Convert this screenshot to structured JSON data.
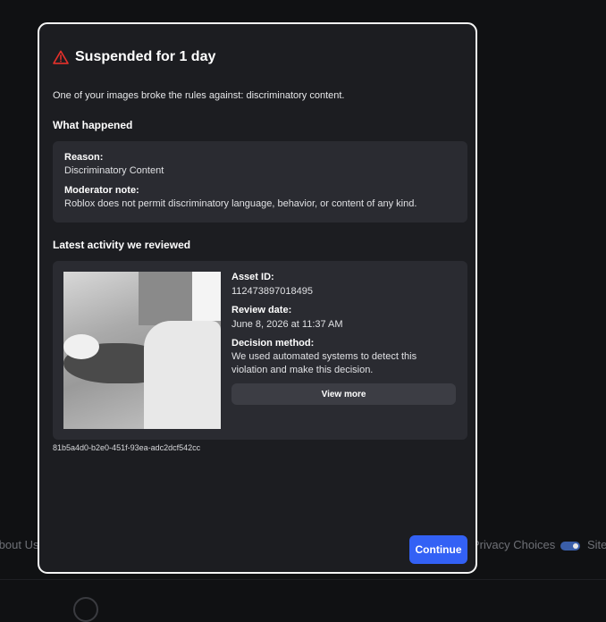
{
  "background": {
    "footer_links": [
      "About Us",
      "Privacy Choices",
      "Site"
    ],
    "copyright": ""
  },
  "modal": {
    "title": "Suspended for 1 day",
    "intro": "One of your images broke the rules against: discriminatory content.",
    "what_happened": {
      "heading": "What happened",
      "reason_label": "Reason:",
      "reason_value": "Discriminatory Content",
      "note_label": "Moderator note:",
      "note_value": "Roblox does not permit discriminatory language, behavior, or content of any kind."
    },
    "activity": {
      "heading": "Latest activity we reviewed",
      "asset_label": "Asset ID:",
      "asset_value": "112473897018495",
      "date_label": "Review date:",
      "date_value": "June 8, 2026 at 11:37 AM",
      "method_label": "Decision method:",
      "method_line1": "We used automated systems to detect this",
      "method_line2": "violation and make this decision.",
      "view_more_label": "View more"
    },
    "case_id": "81b5a4d0-b2e0-451f-93ea-adc2dcf542cc",
    "continue_label": "Continue"
  },
  "colors": {
    "accent": "#3361f5",
    "warning": "#e5312b",
    "card": "#2a2b31",
    "modal": "#1c1d21"
  },
  "icons": {
    "warning": "warning-triangle-icon"
  }
}
